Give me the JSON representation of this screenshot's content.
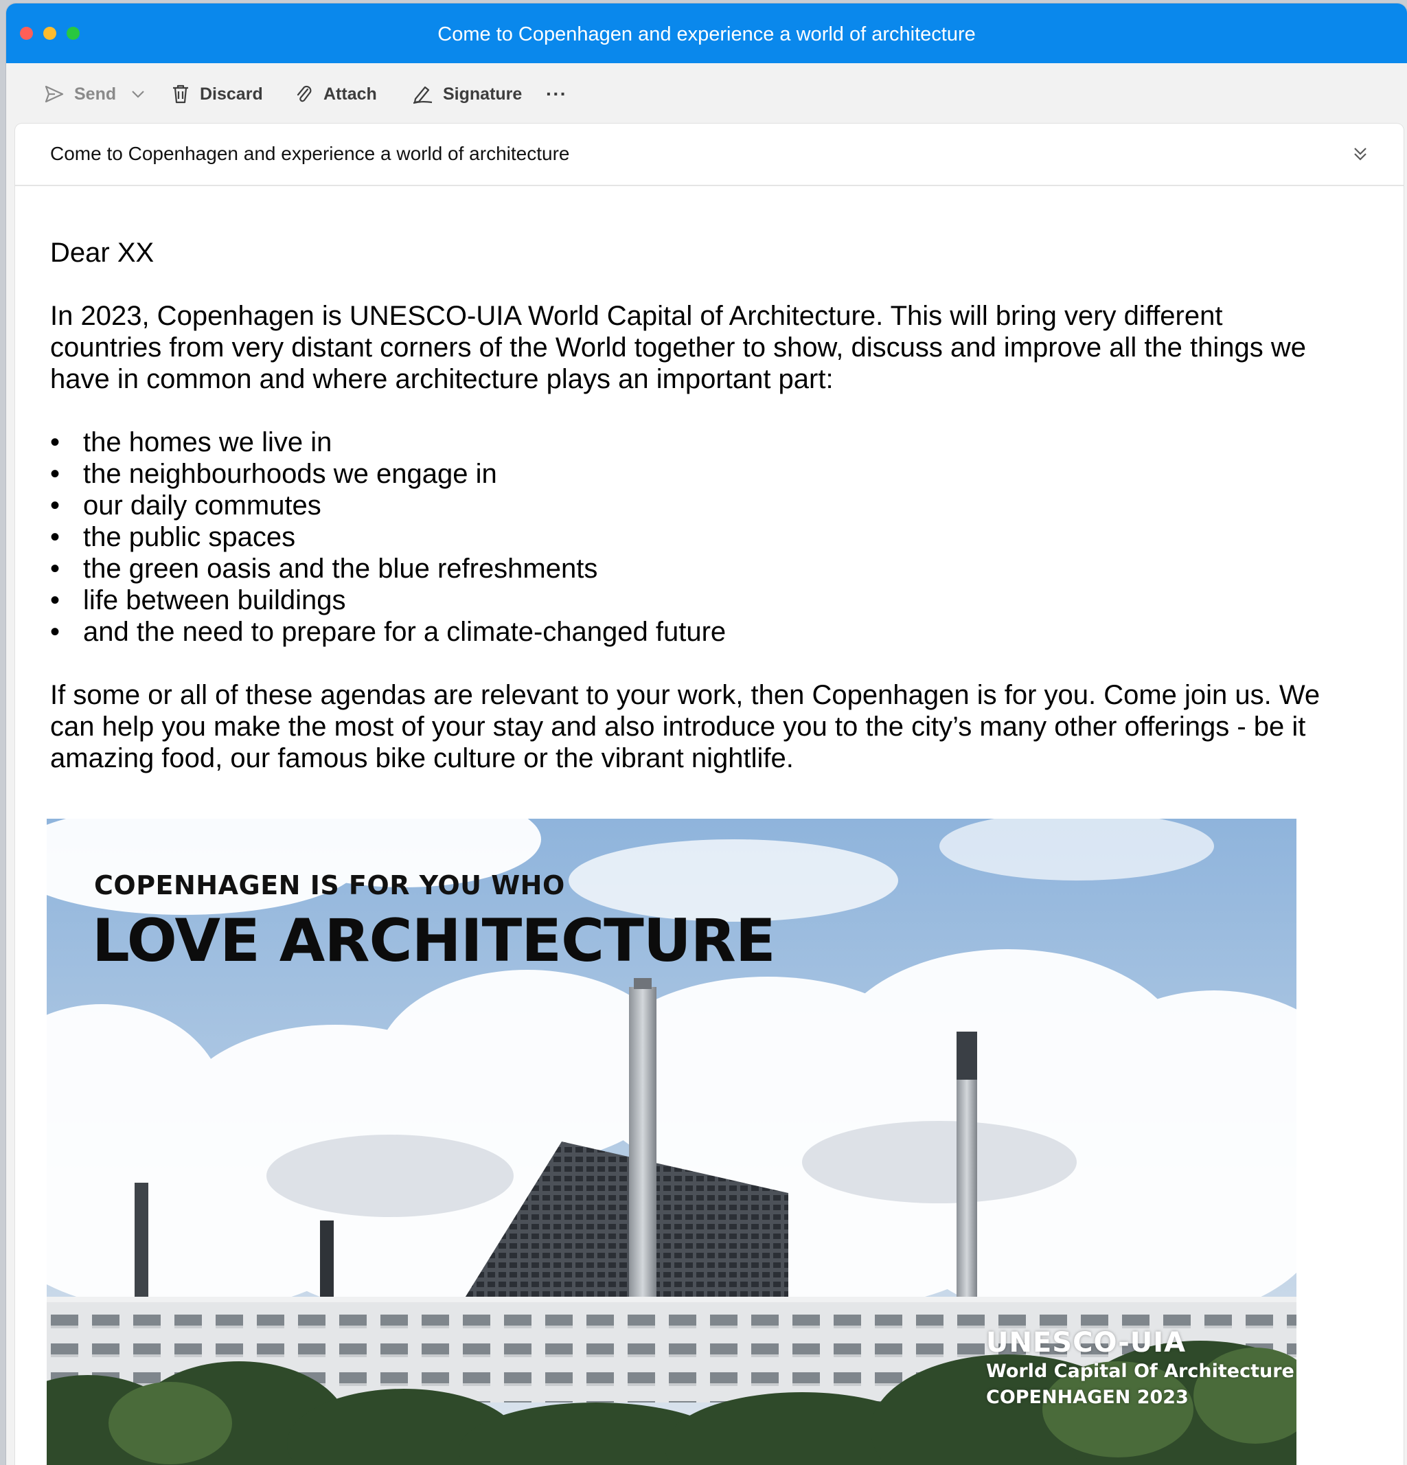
{
  "window": {
    "title": "Come to Copenhagen and experience a world of architecture",
    "accent_color": "#0a88ec"
  },
  "toolbar": {
    "send_label": "Send",
    "discard_label": "Discard",
    "attach_label": "Attach",
    "signature_label": "Signature",
    "more_label": "···"
  },
  "subject": {
    "text": "Come to Copenhagen and experience a world of architecture"
  },
  "message": {
    "greeting": "Dear XX",
    "intro": "In 2023, Copenhagen is UNESCO-UIA World Capital of Architecture. This will bring very different countries from very distant corners of the World together to show, discuss and improve all the things we have in common and where architecture plays an important part:",
    "bullets": [
      "the homes we live in",
      "the neighbourhoods we engage in",
      "our daily commutes",
      "the public spaces",
      "the green oasis and the blue refreshments",
      "life between buildings",
      "and the need to prepare for a climate-changed future"
    ],
    "bullet_symbol": "•",
    "closing": "If some or all of these agendas are relevant to your work, then Copenhagen is for you. Come join us. We can help you make the most of your stay and also introduce you to the city’s many other offerings - be it amazing food, our famous bike culture or the vibrant nightlife."
  },
  "banner": {
    "kicker": "COPENHAGEN IS FOR YOU WHO",
    "headline": "LOVE ARCHITECTURE",
    "badge": {
      "org": "UNESCO-UIA",
      "line1": "World Capital Of Architecture",
      "line2": "COPENHAGEN 2023"
    }
  }
}
